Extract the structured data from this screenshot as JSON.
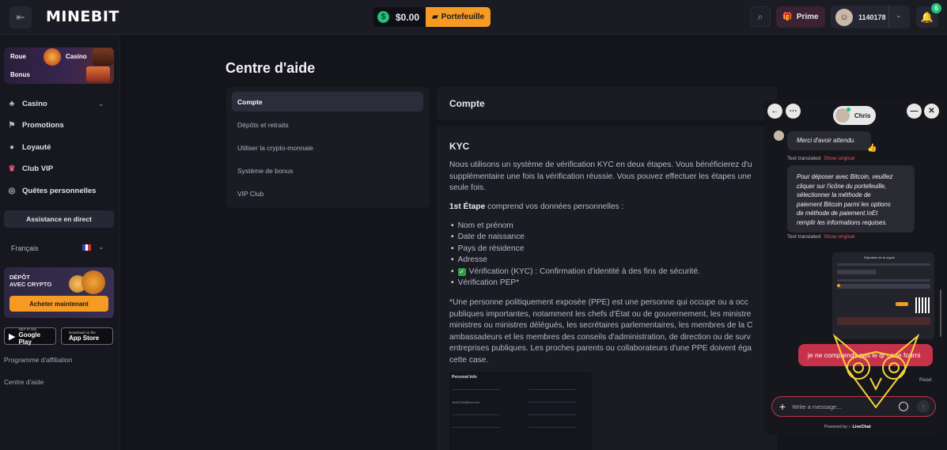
{
  "header": {
    "logo": "MINEBIT",
    "balance": "$0.00",
    "wallet_label": "Portefeuille",
    "prime_label": "Prime",
    "user_id": "1140178",
    "notification_count": "6"
  },
  "sidebar": {
    "promo": {
      "roue": "Roue",
      "casino": "Casino",
      "bonus": "Bonus"
    },
    "nav": [
      {
        "label": "Casino",
        "icon": "cards-icon"
      },
      {
        "label": "Promotions",
        "icon": "flag-icon"
      },
      {
        "label": "Loyauté",
        "icon": "medal-icon"
      },
      {
        "label": "Club VIP",
        "icon": "crown-icon"
      },
      {
        "label": "Quêtes personnelles",
        "icon": "target-icon"
      }
    ],
    "live_support": "Assistance en direct",
    "language": "Français",
    "crypto_title_1": "DÉPÔT",
    "crypto_title_2": "AVEC CRYPTO",
    "buy_now": "Acheter maintenant",
    "google_small": "GET IT ON",
    "google_big": "Google Play",
    "apple_small": "Download on the",
    "apple_big": "App Store",
    "affiliation": "Programme d'affiliation",
    "help_center": "Centre d'aide"
  },
  "main": {
    "title": "Centre d'aide",
    "help_nav": [
      "Compte",
      "Dépôts et retraits",
      "Utiliser la crypto-monnaie",
      "Système de bonus",
      "VIP Club"
    ],
    "section_title": "Compte",
    "kyc_heading": "KYC",
    "para1_line1": "Nous utilisons un système de vérification KYC en deux étapes. Vous bénéficierez d'u",
    "para1_line2": "supplémentaire une fois la vérification réussie. Vous pouvez effectuer les étapes une",
    "para1_line3": "seule fois.",
    "step1_bold": "1st Étape",
    "step1_rest": " comprend vos données personnelles :",
    "bullets": [
      "Nom et prénom",
      "Date de naissance",
      "Pays de résidence",
      "Adresse",
      "Vérification (KYC) : Confirmation d'identité à des fins de sécurité.",
      "Vérification PEP*"
    ],
    "pep_lines": [
      "*Une personne politiquement exposée (PPE) est une personne qui occupe ou a occ",
      "publiques importantes, notamment les chefs d'État ou de gouvernement, les ministre",
      "ministres ou ministres délégués, les secrétaires parlementaires, les membres de la C",
      "ambassadeurs et les membres des conseils d'administration, de direction ou de surv",
      "entreprises publiques. Les proches parents ou collaborateurs d'une PPE doivent éga",
      "cette case."
    ],
    "personal_info_title": "Personal Info",
    "personal_info_email": "test1234@test.com"
  },
  "chat": {
    "agent_name": "Chris",
    "msg1": "Merci d'avoir attendu.",
    "msg1_emoji": "👍",
    "msg2_lines": [
      "Pour déposer avec Bitcoin, veuillez",
      "cliquer sur l'icône du portefeuille,",
      "sélectionner la méthode de",
      "paiement Bitcoin parmi les options",
      "de méthode de paiement.\\nEt",
      "remplir les informations requises."
    ],
    "translated": "Text translated",
    "show_original": "Show original",
    "screenshot_title": "Dépositer de la crypto",
    "user_msg": "je ne comprends pas le qr code fourni",
    "read_status": "Read",
    "input_placeholder": "Write a message...",
    "powered_by": "Powered by",
    "livechat": "LiveChat"
  }
}
